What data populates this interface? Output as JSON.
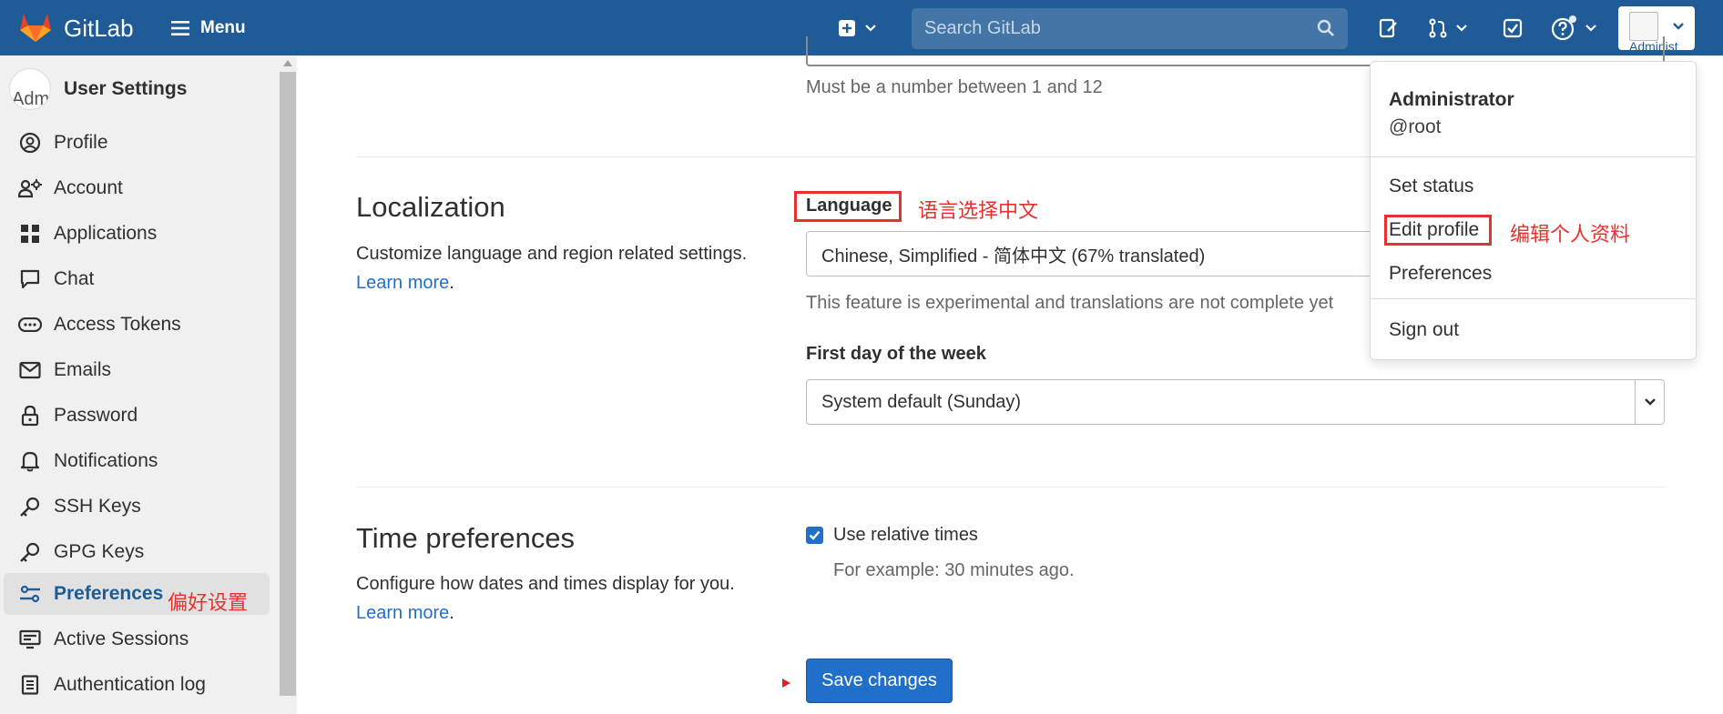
{
  "navbar": {
    "brand": "GitLab",
    "menu_label": "Menu",
    "search_placeholder": "Search GitLab",
    "avatar_alt": "Administ",
    "icons": [
      "gitlab-logo-icon",
      "hamburger-icon",
      "plus-square-icon",
      "search-icon",
      "issues-icon",
      "merge-request-icon",
      "todo-icon",
      "help-icon"
    ]
  },
  "sidebar": {
    "avatar_alt": "Adm",
    "title": "User Settings",
    "items": [
      {
        "label": "Profile",
        "icon": "profile-icon"
      },
      {
        "label": "Account",
        "icon": "account-icon"
      },
      {
        "label": "Applications",
        "icon": "applications-icon"
      },
      {
        "label": "Chat",
        "icon": "chat-icon"
      },
      {
        "label": "Access Tokens",
        "icon": "token-icon"
      },
      {
        "label": "Emails",
        "icon": "mail-icon"
      },
      {
        "label": "Password",
        "icon": "lock-icon"
      },
      {
        "label": "Notifications",
        "icon": "bell-icon"
      },
      {
        "label": "SSH Keys",
        "icon": "key-icon"
      },
      {
        "label": "GPG Keys",
        "icon": "key-icon"
      },
      {
        "label": "Preferences",
        "icon": "preferences-icon",
        "active": true
      },
      {
        "label": "Active Sessions",
        "icon": "monitor-icon"
      },
      {
        "label": "Authentication log",
        "icon": "log-icon"
      }
    ]
  },
  "main": {
    "top_help": "Must be a number between 1 and 12",
    "localization": {
      "title": "Localization",
      "description": "Customize language and region related settings.",
      "learn_more": "Learn more",
      "language_label": "Language",
      "language_value": "Chinese, Simplified - 简体中文 (67% translated)",
      "language_help": "This feature is experimental and translations are not complete yet",
      "first_day_label": "First day of the week",
      "first_day_value": "System default (Sunday)"
    },
    "time": {
      "title": "Time preferences",
      "description": "Configure how dates and times display for you.",
      "learn_more": "Learn more",
      "relative_label": "Use relative times",
      "relative_checked": true,
      "relative_help": "For example: 30 minutes ago."
    },
    "save_label": "Save changes"
  },
  "dropdown": {
    "name": "Administrator",
    "handle": "@root",
    "items": [
      "Set status",
      "Edit profile",
      "Preferences",
      "Sign out"
    ]
  },
  "annotations": {
    "language": "语言选择中文",
    "edit_profile": "编辑个人资料",
    "preferences": "偏好设置"
  },
  "colors": {
    "navbar": "#1f5b96",
    "accent": "#1f6fcb",
    "annotation": "#e83030"
  }
}
